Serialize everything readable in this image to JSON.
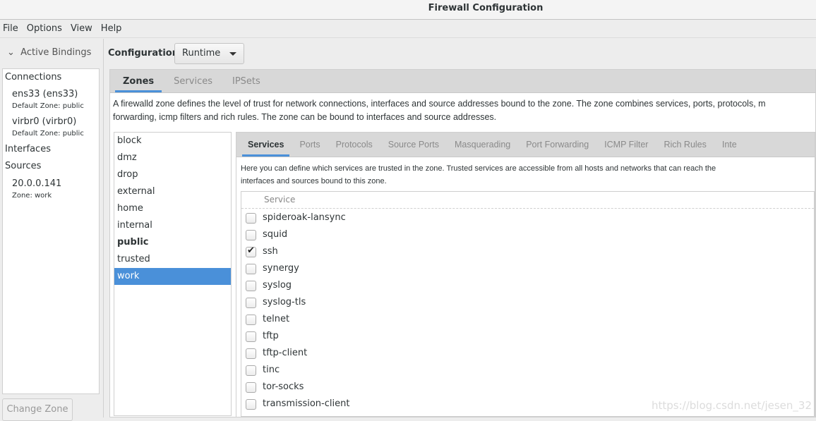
{
  "window": {
    "title": "Firewall Configuration"
  },
  "menu": [
    "File",
    "Options",
    "View",
    "Help"
  ],
  "bindings": {
    "header": "Active Bindings",
    "connections_label": "Connections",
    "connections": [
      {
        "name": "ens33 (ens33)",
        "zone": "Default Zone: public"
      },
      {
        "name": "virbr0 (virbr0)",
        "zone": "Default Zone: public"
      }
    ],
    "interfaces_label": "Interfaces",
    "sources_label": "Sources",
    "sources": [
      {
        "name": "20.0.0.141",
        "zone": "Zone: work"
      }
    ],
    "change_zone": "Change Zone"
  },
  "config": {
    "label": "Configuration:",
    "value": "Runtime"
  },
  "outer_tabs": [
    "Zones",
    "Services",
    "IPSets"
  ],
  "zone_desc": [
    "A firewalld zone defines the level of trust for network connections, interfaces and source addresses bound to the zone. The zone combines services, ports, protocols, m",
    "forwarding, icmp filters and rich rules. The zone can be bound to interfaces and source addresses."
  ],
  "zones": [
    "block",
    "dmz",
    "drop",
    "external",
    "home",
    "internal",
    "public",
    "trusted",
    "work"
  ],
  "default_zone": "public",
  "selected_zone": "work",
  "inner_tabs": [
    "Services",
    "Ports",
    "Protocols",
    "Source Ports",
    "Masquerading",
    "Port Forwarding",
    "ICMP Filter",
    "Rich Rules",
    "Inte"
  ],
  "services_desc": [
    "Here you can define which services are trusted in the zone. Trusted services are accessible from all hosts and networks that can reach the",
    "interfaces and sources bound to this zone."
  ],
  "table": {
    "header": "Service",
    "rows": [
      {
        "name": "spideroak-lansync",
        "checked": false
      },
      {
        "name": "squid",
        "checked": false
      },
      {
        "name": "ssh",
        "checked": true
      },
      {
        "name": "synergy",
        "checked": false
      },
      {
        "name": "syslog",
        "checked": false
      },
      {
        "name": "syslog-tls",
        "checked": false
      },
      {
        "name": "telnet",
        "checked": false
      },
      {
        "name": "tftp",
        "checked": false
      },
      {
        "name": "tftp-client",
        "checked": false
      },
      {
        "name": "tinc",
        "checked": false
      },
      {
        "name": "tor-socks",
        "checked": false
      },
      {
        "name": "transmission-client",
        "checked": false
      }
    ]
  },
  "watermark": "https://blog.csdn.net/jesen_32",
  "colors": {
    "accent": "#4a90d9"
  }
}
